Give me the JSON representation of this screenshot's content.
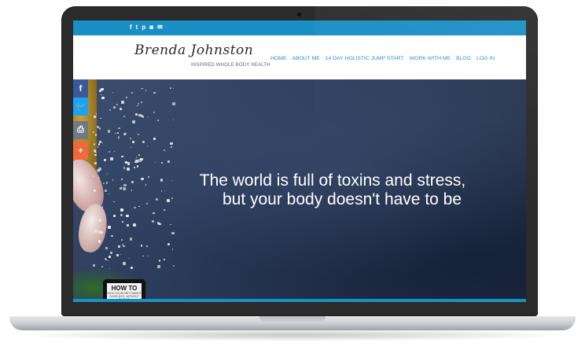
{
  "site": {
    "top_social_icons": [
      "facebook-icon",
      "twitter-icon",
      "pinterest-icon",
      "instagram-icon",
      "email-icon"
    ],
    "top_social_glyphs": [
      "f",
      "t",
      "p",
      "◙",
      "✉"
    ],
    "logo": {
      "name": "Brenda Johnston",
      "tagline": "INSPIRED WHOLE BODY HEALTH"
    },
    "nav": [
      {
        "label": "HOME"
      },
      {
        "label": "ABOUT ME"
      },
      {
        "label": "14 DAY HOLISTIC JUMP START"
      },
      {
        "label": "WORK WITH ME"
      },
      {
        "label": "BLOG"
      },
      {
        "label": "LOG IN"
      }
    ],
    "hero": {
      "line1": "The world is full of toxins and stress,",
      "line2": "but your body doesn't have to be"
    },
    "share_bar": [
      {
        "icon": "facebook-icon",
        "glyph": "f",
        "color": "#3b5998"
      },
      {
        "icon": "twitter-icon",
        "glyph": "🐦",
        "color": "#1da1f2"
      },
      {
        "icon": "print-icon",
        "glyph": "⎙",
        "color": "#6f7a84"
      },
      {
        "icon": "plus-icon",
        "glyph": "+",
        "color": "#f1683c"
      }
    ],
    "book_widget": {
      "title": "HOW TO",
      "subtitle": "KICK YOUR DIET HABITS GOOD BYE, WITHOUT DIETING"
    }
  },
  "colors": {
    "accent": "#1a8fc5",
    "nav_text": "#2d8fc4",
    "hero_bg": "#2c3c5c"
  }
}
